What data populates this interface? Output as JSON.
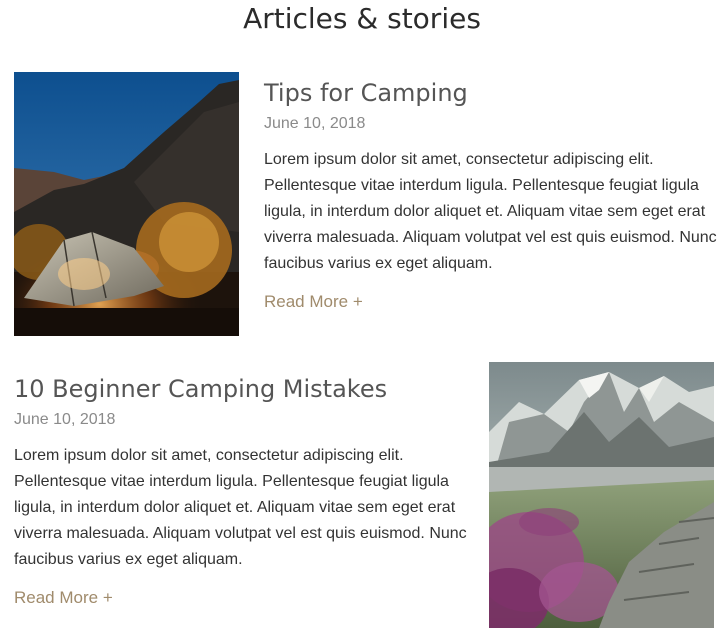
{
  "page": {
    "title": "Articles & stories"
  },
  "articles": [
    {
      "title": "Tips for Camping",
      "date": "June 10, 2018",
      "excerpt": "Lorem ipsum dolor sit amet, consectetur adipiscing elit. Pellentesque vitae interdum ligula. Pellentesque feugiat ligula ligula, in interdum dolor aliquet et. Aliquam vitae sem eget erat viverra malesuada. Aliquam volutpat vel est quis euismod. Nunc faucibus varius ex eget aliquam.",
      "read_more_label": "Read More +",
      "image_alt": "tent at night"
    },
    {
      "title": "10 Beginner Camping Mistakes",
      "date": "June 10, 2018",
      "excerpt": "Lorem ipsum dolor sit amet, consectetur adipiscing elit. Pellentesque vitae interdum ligula. Pellentesque feugiat ligula ligula, in interdum dolor aliquet et. Aliquam vitae sem eget erat viverra malesuada. Aliquam volutpat vel est quis euismod. Nunc faucibus varius ex eget aliquam.",
      "read_more_label": "Read More +",
      "image_alt": "mountain landscape"
    }
  ],
  "colors": {
    "title_text": "#2b2b2b",
    "article_title": "#555555",
    "date_text": "#8a8a8a",
    "body_text": "#333333",
    "read_more_accent": "#a08b6c"
  }
}
